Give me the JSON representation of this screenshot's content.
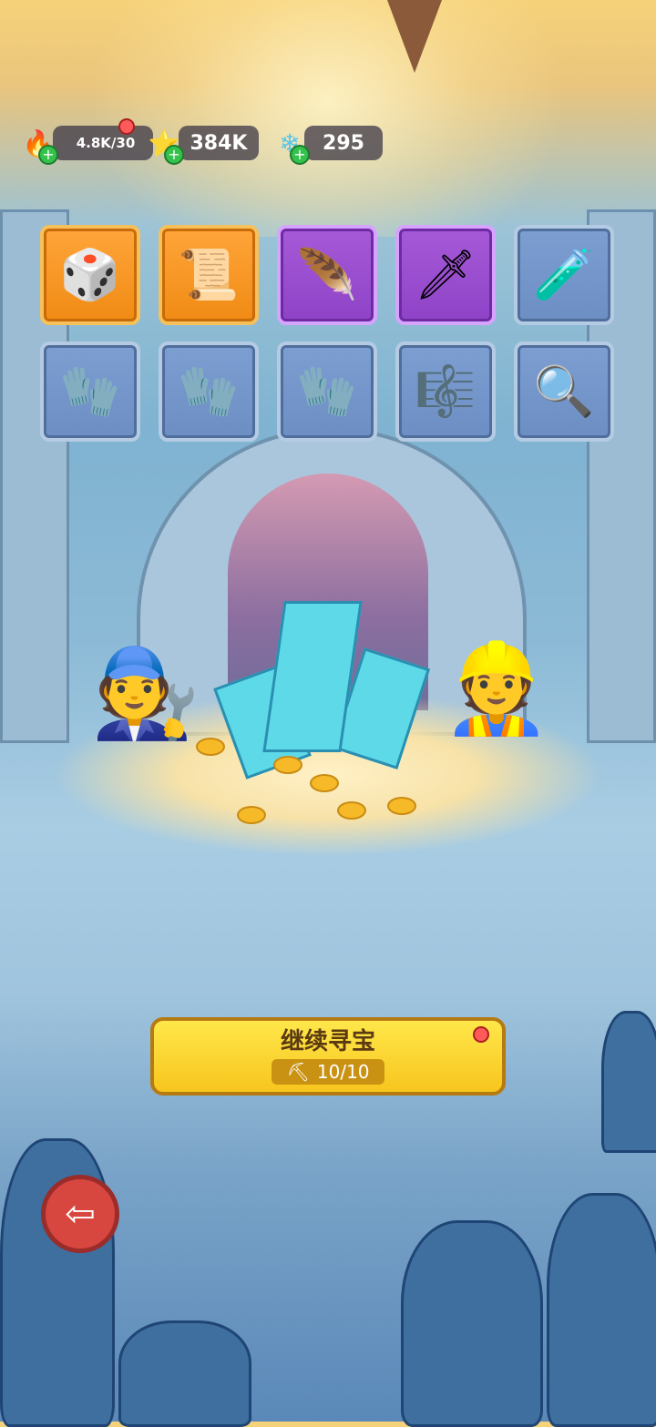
{
  "hud": {
    "energy": {
      "value": "4.8K/30",
      "icon": "flame-icon"
    },
    "gold": {
      "value": "384K",
      "icon": "gold-coin-icon"
    },
    "crystal": {
      "value": "295",
      "icon": "blue-crystal-icon"
    }
  },
  "inventory": [
    {
      "icon": "d20-dice-icon",
      "glyph": "🎲",
      "rarity": "orange"
    },
    {
      "icon": "scroll-letter-icon",
      "glyph": "📜",
      "rarity": "orange"
    },
    {
      "icon": "phoenix-feather-icon",
      "glyph": "🪶",
      "rarity": "purple"
    },
    {
      "icon": "frost-dagger-icon",
      "glyph": "🗡",
      "rarity": "purple"
    },
    {
      "icon": "red-potion-icon",
      "glyph": "🧪",
      "rarity": "blue"
    },
    {
      "icon": "leather-glove-icon",
      "glyph": "🧤",
      "rarity": "blue"
    },
    {
      "icon": "leather-glove-icon",
      "glyph": "🧤",
      "rarity": "blue"
    },
    {
      "icon": "leather-glove-icon",
      "glyph": "🧤",
      "rarity": "blue"
    },
    {
      "icon": "golden-lyre-icon",
      "glyph": "🎼",
      "rarity": "blue"
    },
    {
      "icon": "magnifying-glass-icon",
      "glyph": "🔍",
      "rarity": "blue"
    }
  ],
  "continue_button": {
    "label": "继续寻宝",
    "count": "10/10",
    "icon": "pickaxe-icon"
  },
  "back_button": {
    "icon": "back-arrow-icon"
  },
  "colors": {
    "accent_yellow": "#f7c51d",
    "notification_red": "#ff5a5a"
  }
}
